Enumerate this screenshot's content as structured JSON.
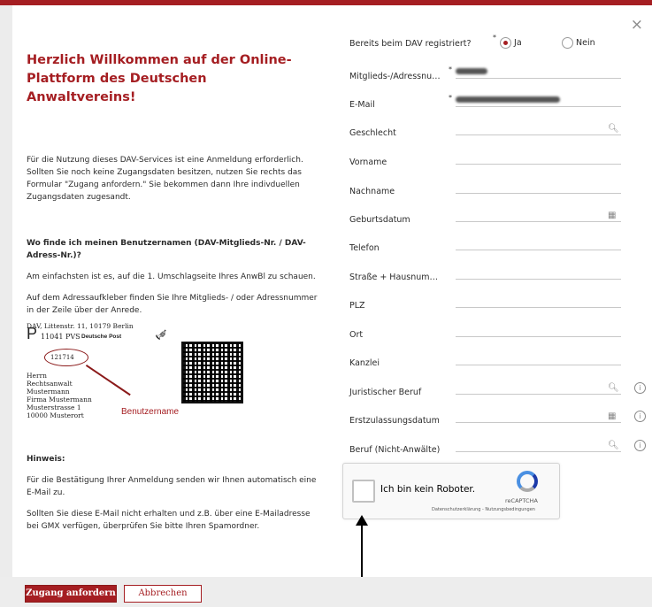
{
  "modal": {
    "close": "×",
    "title": "Herzlich Willkommen auf der Online-Plattform des Deutschen Anwaltvereins!",
    "intro": "Für die Nutzung dieses DAV-Services ist eine Anmeldung erforderlich. Sollten Sie noch keine Zugangsdaten besitzen, nutzen Sie rechts das Formular \"Zugang anfordern.\" Sie bekommen dann Ihre indivduellen Zugangsdaten zugesandt.",
    "faq_title": "Wo finde ich meinen Benutzernamen (DAV-Mitglieds-Nr. / DAV-Adress-Nr.)?",
    "faq_p1": "Am einfachsten ist es, auf die 1. Umschlagseite Ihres AnwBl zu schauen.",
    "faq_p2": "Auf dem Adressaufkleber finden Sie Ihre Mitglieds- / oder Adressnummer in der Zeile über der Anrede.",
    "label_image": {
      "line1": "DAV, Littenstr. 11, 10179 Berlin",
      "p_letter": "P",
      "line2": "11041 PVS",
      "post": "Deutsche Post",
      "number": "121714",
      "addr": [
        "Herrn",
        "Rechtsanwalt",
        "Mustermann",
        "Firma Mustermann",
        "Musterstrasse 1",
        "10000 Musterort"
      ],
      "caption": "Benutzername"
    },
    "hint_title": "Hinweis:",
    "hint_p1": "Für die Bestätigung Ihrer Anmeldung senden wir Ihnen automatisch eine E-Mail zu.",
    "hint_p2": "Sollten Sie diese E-Mail nicht erhalten und z.B. über eine E-Mailadresse bei GMX verfügen, überprüfen Sie bitte Ihren Spamordner."
  },
  "form": {
    "registered_label": "Bereits beim DAV registriert?",
    "yes": "Ja",
    "no": "Nein",
    "fields": {
      "member": "Mitglieds-/Adressnu…",
      "email": "E-Mail",
      "gender": "Geschlecht",
      "firstname": "Vorname",
      "lastname": "Nachname",
      "birthdate": "Geburtsdatum",
      "phone": "Telefon",
      "street": "Straße + Hausnum…",
      "zip": "PLZ",
      "city": "Ort",
      "office": "Kanzlei",
      "legal_job": "Juristischer Beruf",
      "admission": "Erstzulassungsdatum",
      "job_other": "Beruf (Nicht-Anwälte)"
    }
  },
  "captcha": {
    "label": "Ich bin kein Roboter.",
    "brand": "reCAPTCHA",
    "terms": "Datenschutzerklärung - Nutzungsbedingungen"
  },
  "footer": {
    "submit": "Zugang anfordern",
    "cancel": "Abbrechen"
  },
  "colors": {
    "accent": "#a51e22"
  }
}
